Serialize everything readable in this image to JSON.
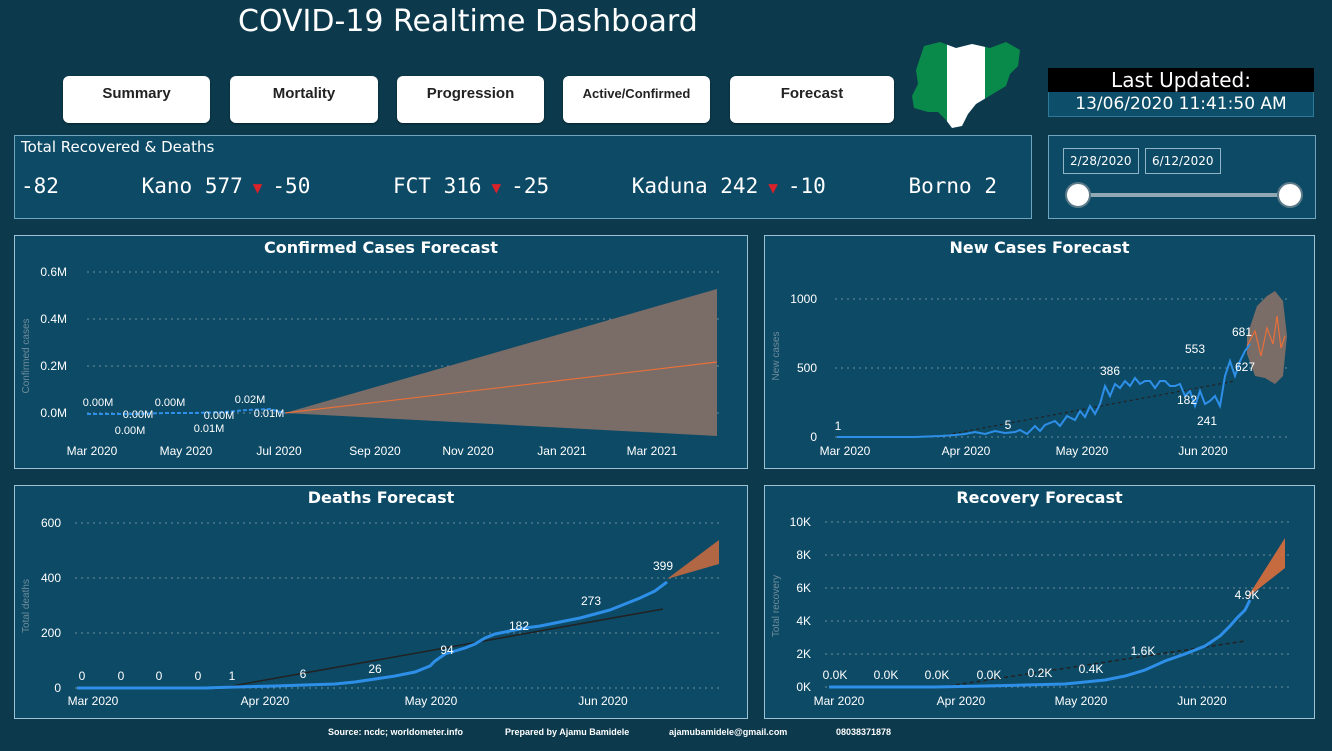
{
  "header": {
    "title": "COVID-19 Realtime Dashboard"
  },
  "nav": [
    "Summary",
    "Mortality",
    "Progression",
    "Active/Confirmed",
    "Forecast"
  ],
  "last_updated": {
    "label": "Last Updated:",
    "value": "13/06/2020 11:41:50 AM"
  },
  "ticker": {
    "title": "Total Recovered & Deaths",
    "lead": "-82",
    "items": [
      {
        "state": "Kano",
        "value": "577",
        "change": "-50"
      },
      {
        "state": "FCT",
        "value": "316",
        "change": "-25"
      },
      {
        "state": "Kaduna",
        "value": "242",
        "change": "-10"
      },
      {
        "state": "Borno",
        "value": "2",
        "change": ""
      }
    ]
  },
  "slicer": {
    "start": "2/28/2020",
    "end": "6/12/2020"
  },
  "colors": {
    "bg": "#0c3a4c",
    "panel": "#0d4a66",
    "line": "#2e8fe8",
    "forecast": "#e8703a",
    "band": "#7a6c66"
  },
  "chart_data": [
    {
      "id": "confirmed",
      "type": "line",
      "title": "Confirmed Cases Forecast",
      "ylabel": "Confirmed cases",
      "y_ticks": [
        "0.6M",
        "0.4M",
        "0.2M",
        "0.0M"
      ],
      "x_ticks": [
        "Mar 2020",
        "May 2020",
        "Jul 2020",
        "Sep 2020",
        "Nov 2020",
        "Jan 2021",
        "Mar 2021"
      ],
      "data_labels": [
        "0.00M",
        "0.00M",
        "0.00M",
        "0.00M",
        "0.01M",
        "0.00M",
        "0.02M",
        "0.01M"
      ],
      "actual": [
        0,
        0,
        0.001,
        0.002,
        0.004,
        0.008,
        0.012,
        0.016
      ],
      "forecast_end": 0.22,
      "band_upper_end": 0.53,
      "band_lower_end": -0.09,
      "ylim": [
        0,
        0.6
      ]
    },
    {
      "id": "newcases",
      "type": "line",
      "title": "New Cases Forecast",
      "ylabel": "New cases",
      "y_ticks": [
        "1000",
        "500",
        "0"
      ],
      "x_ticks": [
        "Mar 2020",
        "Apr 2020",
        "May 2020",
        "Jun 2020"
      ],
      "data_labels": [
        "1",
        "5",
        "386",
        "553",
        "182",
        "241",
        "681",
        "627"
      ],
      "ylim": [
        0,
        1000
      ]
    },
    {
      "id": "deaths",
      "type": "line",
      "title": "Deaths Forecast",
      "ylabel": "Total deaths",
      "y_ticks": [
        "600",
        "400",
        "200",
        "0"
      ],
      "x_ticks": [
        "Mar 2020",
        "Apr 2020",
        "May 2020",
        "Jun 2020"
      ],
      "data_labels": [
        "0",
        "0",
        "0",
        "0",
        "1",
        "6",
        "26",
        "94",
        "182",
        "273",
        "399"
      ],
      "ylim": [
        0,
        600
      ]
    },
    {
      "id": "recovery",
      "type": "line",
      "title": "Recovery Forecast",
      "ylabel": "Total recovery",
      "y_ticks": [
        "10K",
        "8K",
        "6K",
        "4K",
        "2K",
        "0K"
      ],
      "x_ticks": [
        "Mar 2020",
        "Apr 2020",
        "May 2020",
        "Jun 2020"
      ],
      "data_labels": [
        "0.0K",
        "0.0K",
        "0.0K",
        "0.0K",
        "0.2K",
        "0.4K",
        "1.6K",
        "4.9K"
      ],
      "ylim": [
        0,
        10000
      ]
    }
  ],
  "footer": {
    "source": "Source: ncdc; worldometer.info",
    "prepared": "Prepared by Ajamu Bamidele",
    "email": "ajamubamidele@gmail.com",
    "phone": "08038371878"
  }
}
